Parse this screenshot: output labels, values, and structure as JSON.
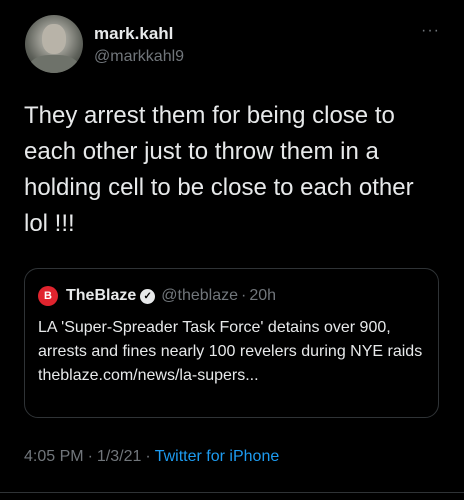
{
  "tweet": {
    "display_name": "mark.kahl",
    "handle": "@markkahl9",
    "more_glyph": "···",
    "text": "They arrest them for being close to\neach other just to throw them in a\nholding cell to be close to each other\nlol !!!",
    "time": "4:05 PM",
    "date": "1/3/21",
    "separator": "·",
    "source": "Twitter for iPhone"
  },
  "quoted_tweet": {
    "logo_glyph": "B",
    "name": "TheBlaze",
    "verified_glyph": "✓",
    "handle": "@theblaze",
    "separator": "·",
    "time_ago": "20h",
    "text": "LA 'Super-Spreader Task Force' detains over 900, arrests and fines nearly 100 revelers during NYE raids theblaze.com/news/la-supers..."
  },
  "icons": {
    "avatar": "user-avatar",
    "more": "more-horizontal-icon",
    "quoted_logo": "theblaze-logo",
    "verified": "verified-badge-icon"
  },
  "colors": {
    "background": "#000000",
    "text_primary": "#e7e9ea",
    "text_secondary": "#71767b",
    "link": "#1d9bf0",
    "border": "#2f3336",
    "blaze_red": "#e0242e"
  }
}
